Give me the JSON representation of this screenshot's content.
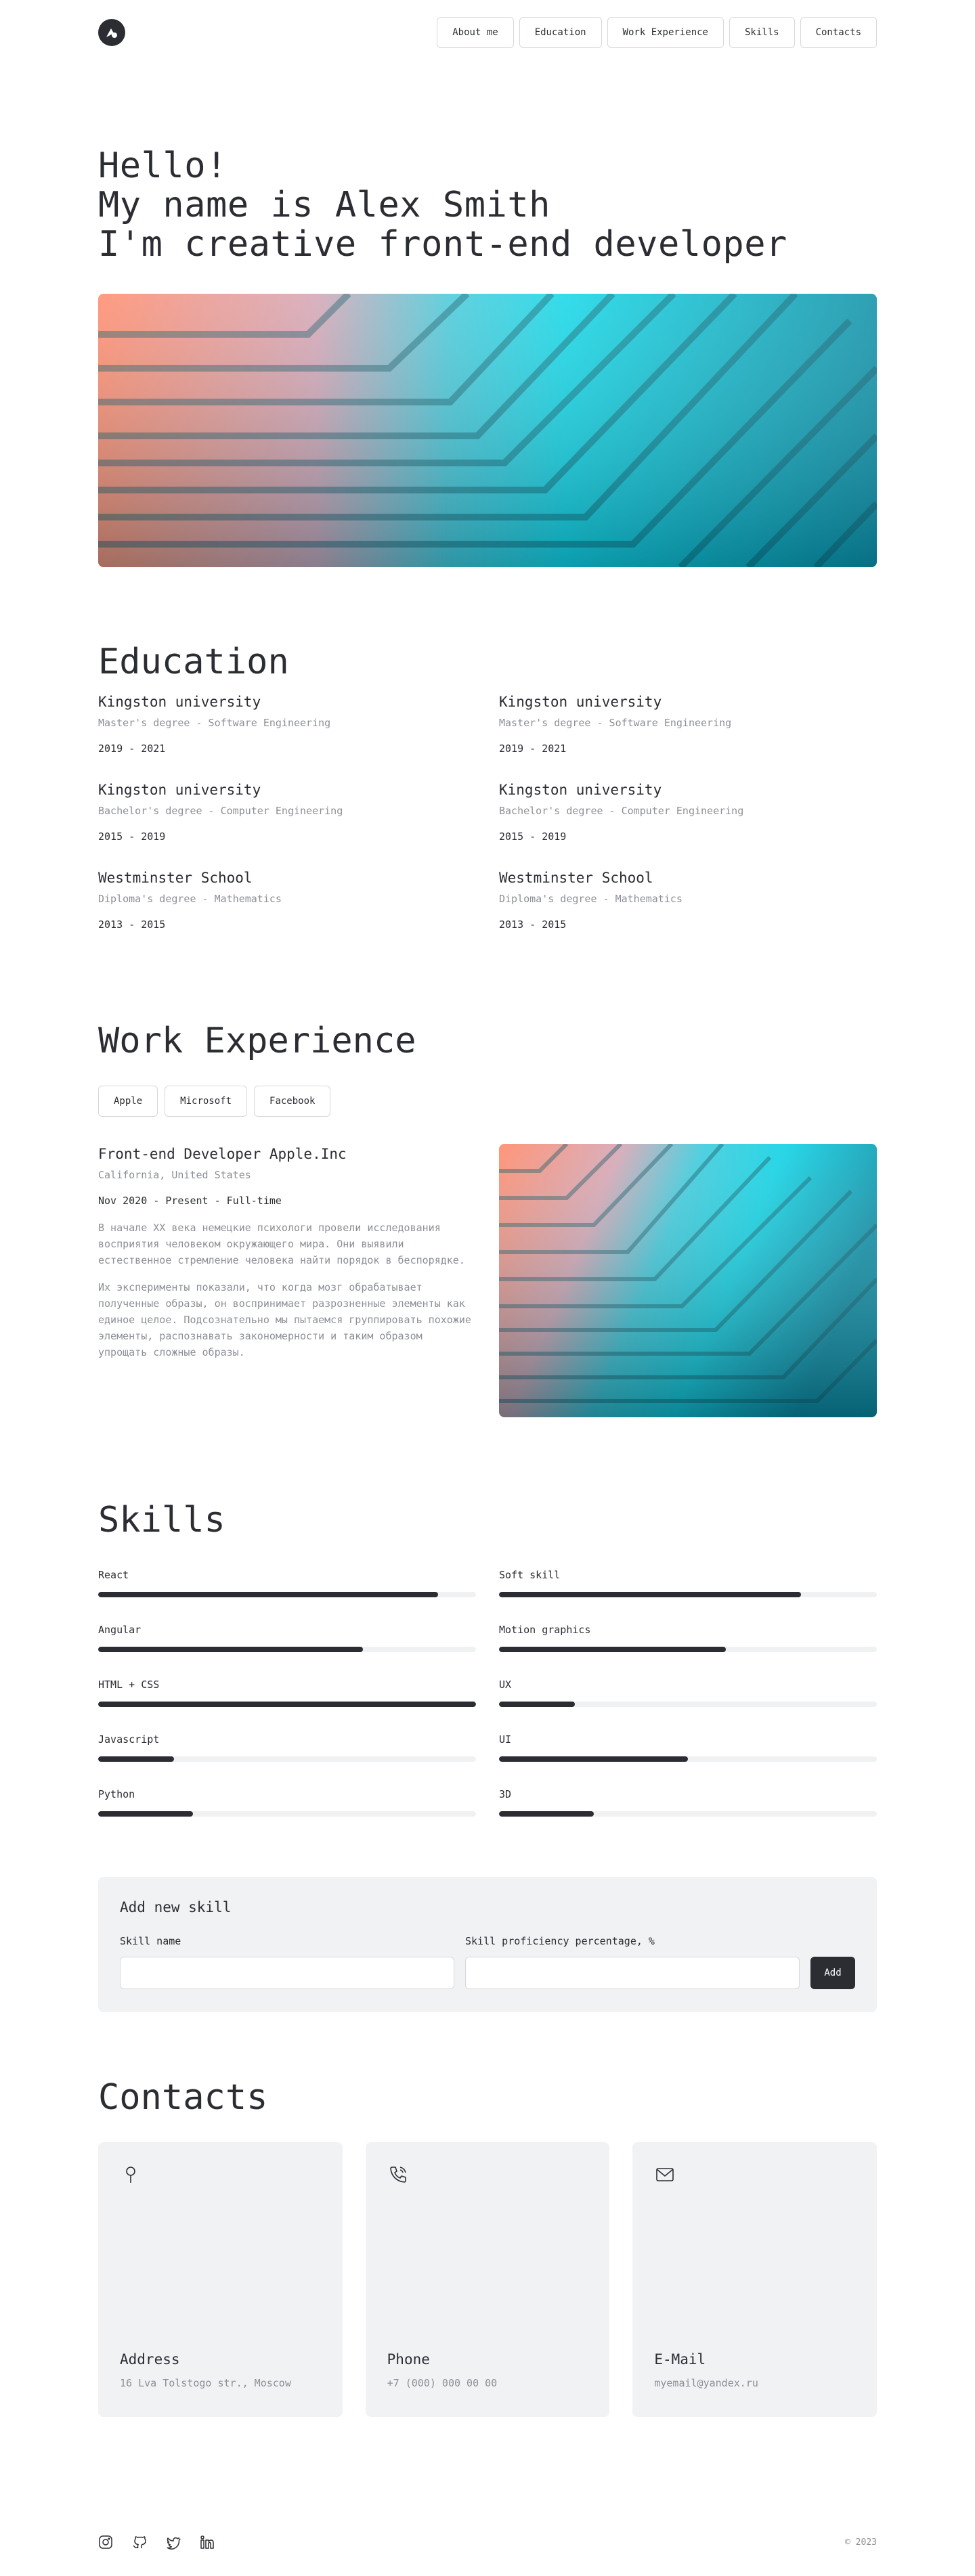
{
  "nav": {
    "logo_icon": "logo-icon",
    "items": [
      "About me",
      "Education",
      "Work Experience",
      "Skills",
      "Contacts"
    ]
  },
  "hero": {
    "line1": "Hello!",
    "line2": "My name is Alex Smith",
    "line3": "I'm creative front-end developer"
  },
  "education": {
    "title": "Education",
    "items": [
      {
        "name": "Kingston university",
        "degree": "Master's degree - Software Engineering",
        "years": "2019 - 2021"
      },
      {
        "name": "Kingston university",
        "degree": "Master's degree - Software Engineering",
        "years": "2019 - 2021"
      },
      {
        "name": "Kingston university",
        "degree": "Bachelor's degree - Computer Engineering",
        "years": "2015 - 2019"
      },
      {
        "name": "Kingston university",
        "degree": "Bachelor's degree - Computer Engineering",
        "years": "2015 - 2019"
      },
      {
        "name": "Westminster School",
        "degree": "Diploma's degree - Mathematics",
        "years": "2013 - 2015"
      },
      {
        "name": "Westminster School",
        "degree": "Diploma's degree - Mathematics",
        "years": "2013 - 2015"
      }
    ]
  },
  "work": {
    "title": "Work Experience",
    "tabs": [
      "Apple",
      "Microsoft",
      "Facebook"
    ],
    "job_title": "Front-end Developer Apple.Inc",
    "location": "California, United States",
    "period": "Nov 2020 - Present - Full-time",
    "paragraph1": "В начале XX века немецкие психологи провели исследования восприятия человеком окружающего мира. Они выявили естественное стремление человека найти порядок в беспорядке.",
    "paragraph2": "Их эксперименты показали, что когда мозг обрабатывает полученные образы, он воспринимает разрозненные элементы как единое целое. Подсознательно мы пытаемся группировать похожие элементы, распознавать закономерности и таким образом упрощать сложные образы."
  },
  "skills": {
    "title": "Skills",
    "items": [
      {
        "name": "React",
        "level": 0.9
      },
      {
        "name": "Soft skill",
        "level": 0.8
      },
      {
        "name": "Angular",
        "level": 0.7
      },
      {
        "name": "Motion graphics",
        "level": 0.6
      },
      {
        "name": "HTML + CSS",
        "level": 1.0
      },
      {
        "name": "UX",
        "level": 0.2
      },
      {
        "name": "Javascript",
        "level": 0.2
      },
      {
        "name": "UI",
        "level": 0.5
      },
      {
        "name": "Python",
        "level": 0.25
      },
      {
        "name": "3D",
        "level": 0.25
      }
    ],
    "form": {
      "title": "Add new skill",
      "name_label": "Skill name",
      "name_value": "",
      "percent_label": "Skill proficiency percentage, %",
      "percent_value": "",
      "button": "Add"
    }
  },
  "contacts": {
    "title": "Contacts",
    "cards": [
      {
        "icon": "location-pin-icon",
        "label": "Address",
        "value": "16 Lva Tolstogo str., Moscow"
      },
      {
        "icon": "phone-icon",
        "label": "Phone",
        "value": "+7 (000) 000 00 00"
      },
      {
        "icon": "mail-icon",
        "label": "E-Mail",
        "value": "myemail@yandex.ru"
      }
    ]
  },
  "footer": {
    "socials": [
      "instagram-icon",
      "github-icon",
      "twitter-icon",
      "linkedin-icon"
    ],
    "copyright": "© 2023"
  },
  "colors": {
    "text": "#2b2d33",
    "muted": "#8c8f96",
    "card_bg": "#f1f2f4",
    "accent_teal": "#0fc7dc",
    "accent_coral": "#ff8a6b"
  }
}
